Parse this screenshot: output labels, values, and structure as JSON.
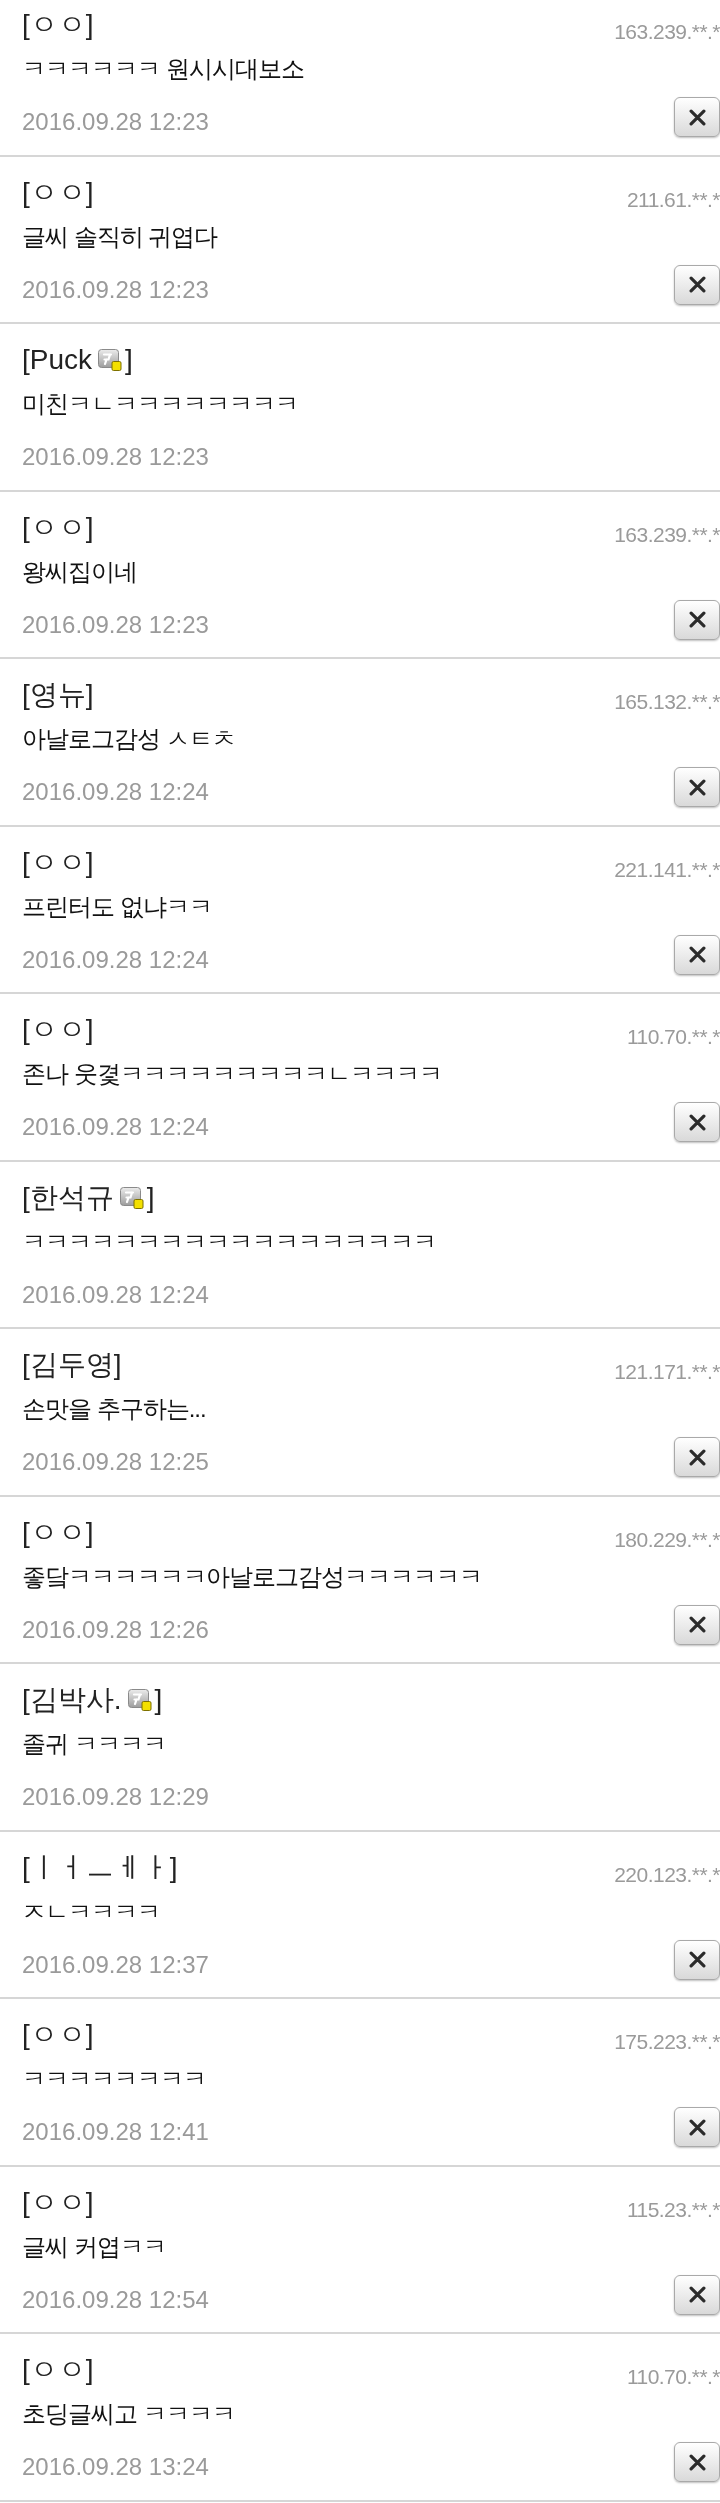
{
  "comments": [
    {
      "author": "[ㅇㅇ]",
      "member_badge": false,
      "ip": "163.239.**.*",
      "text": "ㅋㅋㅋㅋㅋㅋ 원시시대보소",
      "date": "2016.09.28 12:23",
      "deletable": true
    },
    {
      "author": "[ㅇㅇ]",
      "member_badge": false,
      "ip": "211.61.**.*",
      "text": "글씨 솔직히 귀엽다",
      "date": "2016.09.28 12:23",
      "deletable": true
    },
    {
      "author": "[Puck",
      "member_badge": true,
      "author_close": "]",
      "text": "미친ㅋㄴㅋㅋㅋㅋㅋㅋㅋㅋ",
      "date": "2016.09.28 12:23",
      "deletable": false
    },
    {
      "author": "[ㅇㅇ]",
      "member_badge": false,
      "ip": "163.239.**.*",
      "text": "왕씨집이네",
      "date": "2016.09.28 12:23",
      "deletable": true
    },
    {
      "author": "[영뉴]",
      "member_badge": false,
      "ip": "165.132.**.*",
      "text": "아날로그감성 ㅅㅌㅊ",
      "date": "2016.09.28 12:24",
      "deletable": true
    },
    {
      "author": "[ㅇㅇ]",
      "member_badge": false,
      "ip": "221.141.**.*",
      "text": "프린터도 없냐ㅋㅋ",
      "date": "2016.09.28 12:24",
      "deletable": true
    },
    {
      "author": "[ㅇㅇ]",
      "member_badge": false,
      "ip": "110.70.**.*",
      "text": "존나 웃겿ㅋㅋㅋㅋㅋㅋㅋㅋㅋㄴㅋㅋㅋㅋ",
      "date": "2016.09.28 12:24",
      "deletable": true
    },
    {
      "author": "[한석규",
      "member_badge": true,
      "author_close": "]",
      "text": "ㅋㅋㅋㅋㅋㅋㅋㅋㅋㅋㅋㅋㅋㅋㅋㅋㅋㅋ",
      "date": "2016.09.28 12:24",
      "deletable": false
    },
    {
      "author": "[김두영]",
      "member_badge": false,
      "ip": "121.171.**.*",
      "text": "손맛을 추구하는...",
      "date": "2016.09.28 12:25",
      "deletable": true
    },
    {
      "author": "[ㅇㅇ]",
      "member_badge": false,
      "ip": "180.229.**.*",
      "text": "좋닼ㅋㅋㅋㅋㅋㅋ아날로그감성ㅋㅋㅋㅋㅋㅋ",
      "date": "2016.09.28 12:26",
      "deletable": true
    },
    {
      "author": "[김박사.",
      "member_badge": true,
      "author_close": "]",
      "text": "졸귀 ㅋㅋㅋㅋ",
      "date": "2016.09.28 12:29",
      "deletable": false
    },
    {
      "author": "[ㅣㅓㅡㅔㅏ]",
      "member_badge": false,
      "ip": "220.123.**.*",
      "text": "ㅈㄴㅋㅋㅋㅋ",
      "date": "2016.09.28 12:37",
      "deletable": true
    },
    {
      "author": "[ㅇㅇ]",
      "member_badge": false,
      "ip": "175.223.**.*",
      "text": "ㅋㅋㅋㅋㅋㅋㅋㅋ",
      "date": "2016.09.28 12:41",
      "deletable": true
    },
    {
      "author": "[ㅇㅇ]",
      "member_badge": false,
      "ip": "115.23.**.*",
      "text": "글씨 커엽ㅋㅋ",
      "date": "2016.09.28 12:54",
      "deletable": true
    },
    {
      "author": "[ㅇㅇ]",
      "member_badge": false,
      "ip": "110.70.**.*",
      "text": "초딩글씨고 ㅋㅋㅋㅋ",
      "date": "2016.09.28 13:24",
      "deletable": true
    }
  ]
}
